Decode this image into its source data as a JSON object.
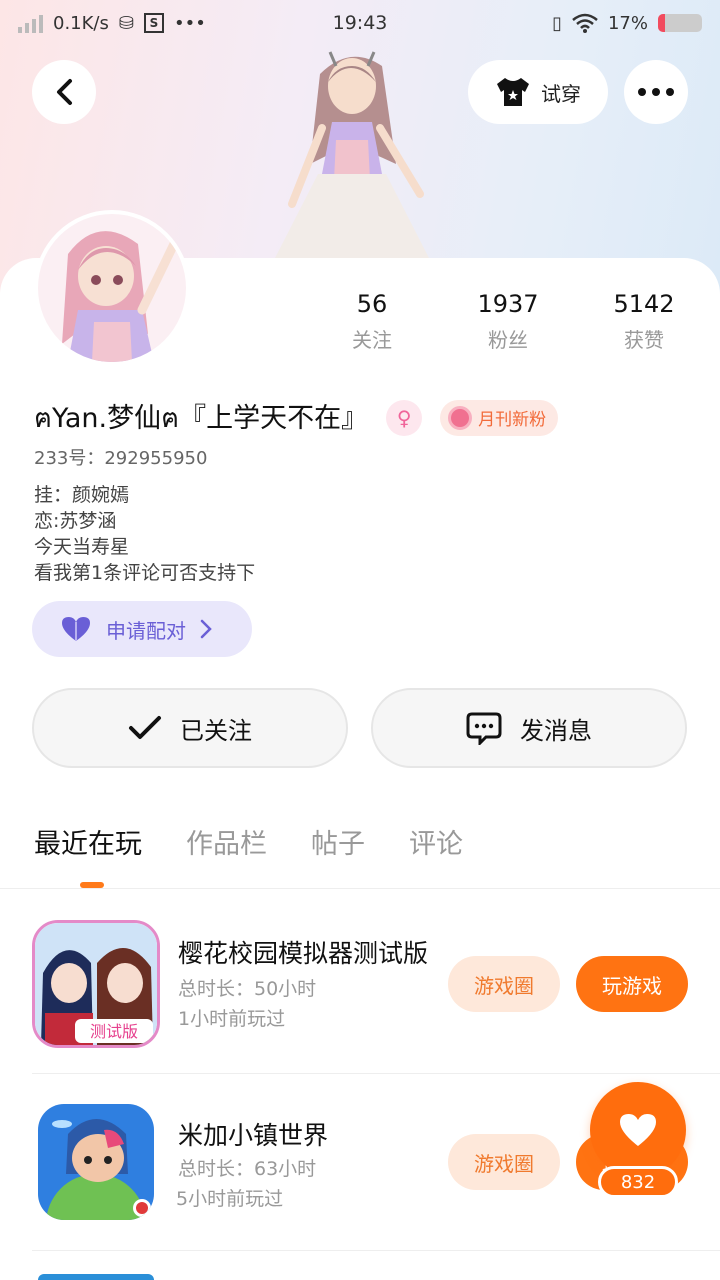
{
  "status_bar": {
    "speed": "0.1K/s",
    "box_icon_label": "S",
    "more": "•••",
    "time": "19:43",
    "battery": "17%",
    "battery_level": 0.17
  },
  "header": {
    "try_on_label": "试穿",
    "more_label": "•••"
  },
  "stats": [
    {
      "value": "56",
      "label": "关注"
    },
    {
      "value": "1937",
      "label": "粉丝"
    },
    {
      "value": "5142",
      "label": "获赞"
    }
  ],
  "profile": {
    "username": "ฅYan.梦仙ฅ『上学天不在』",
    "gender_symbol": "♀",
    "badge": "月刊新粉",
    "uid": "233号：292955950",
    "bio_lines": [
      "挂：颜婉嫣",
      "恋:苏梦涵",
      "今天当寿星",
      "看我第1条评论可否支持下"
    ],
    "pair_label": "申请配对"
  },
  "actions": {
    "followed_label": "已关注",
    "message_label": "发消息"
  },
  "tabs": [
    "最近在玩",
    "作品栏",
    "帖子",
    "评论"
  ],
  "games": [
    {
      "title": "樱花校园模拟器测试版",
      "duration": "总时长：50小时",
      "last_played": "1小时前玩过",
      "icon_badge": "测试版",
      "circle_label": "游戏圈",
      "play_label": "玩游戏"
    },
    {
      "title": "米加小镇世界",
      "duration": "总时长：63小时",
      "last_played": "5小时前玩过",
      "circle_label": "游戏圈",
      "play_label": "玩游戏"
    }
  ],
  "like_count": "832",
  "colors": {
    "accent": "#ff7312",
    "pair_purple": "#6a5fd6",
    "badge_orange": "#f26b3a"
  }
}
